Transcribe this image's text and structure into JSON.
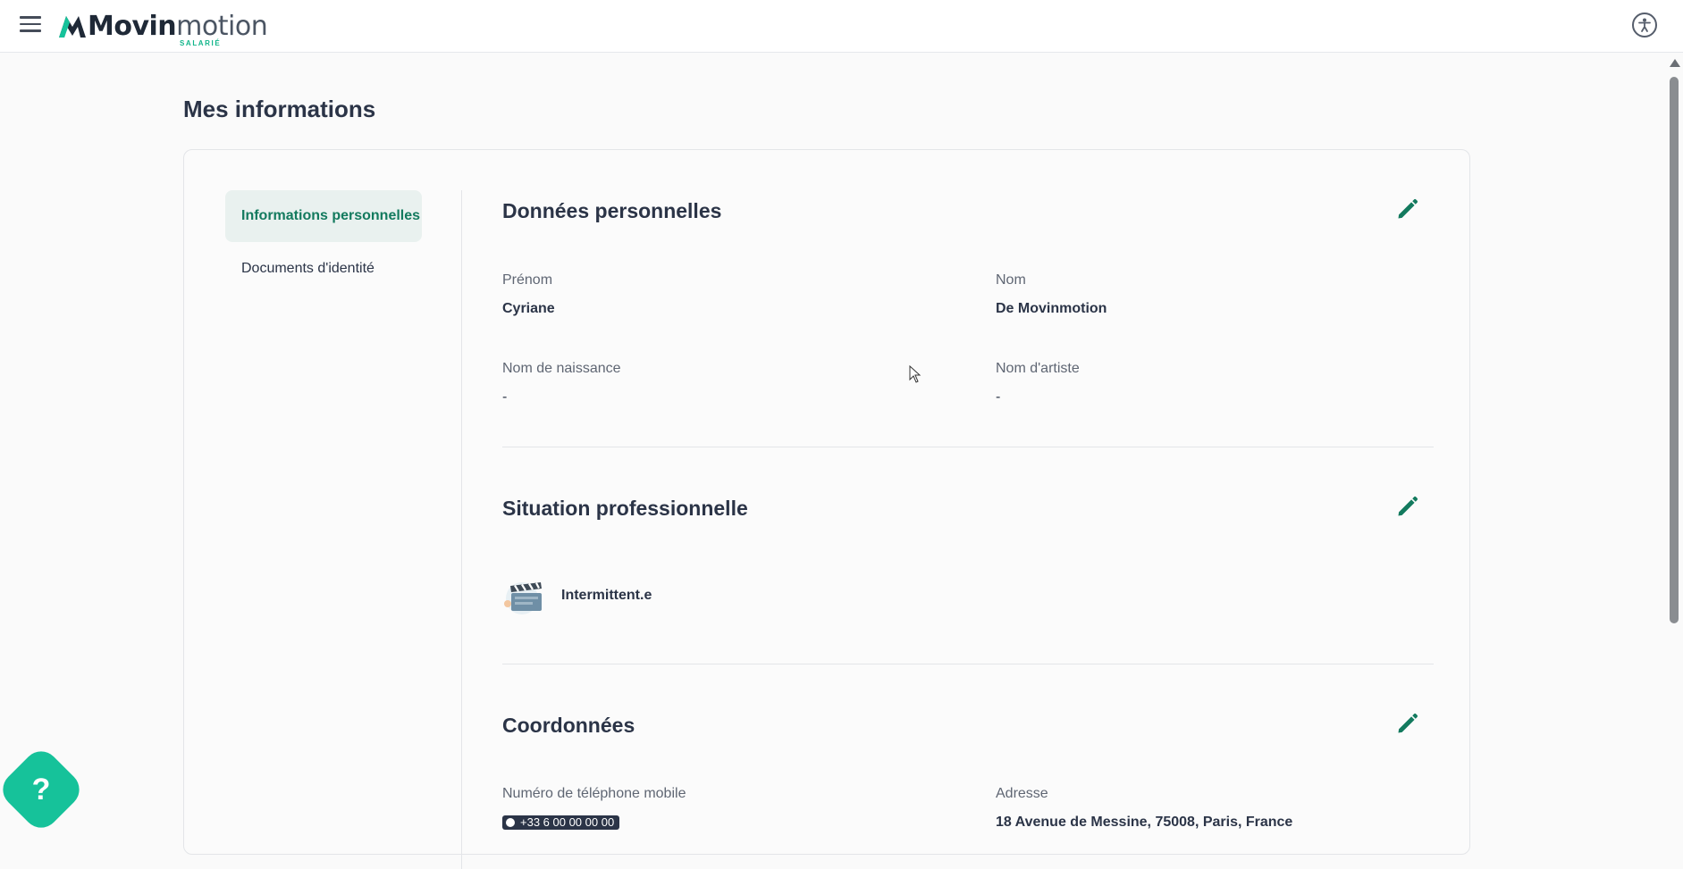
{
  "header": {
    "logo_text_bold": "Movin",
    "logo_text_light": "motion",
    "logo_subtitle": "SALARIÉ",
    "menu_icon": "hamburger-icon",
    "accessibility_icon": "accessibility-icon"
  },
  "page": {
    "title": "Mes informations"
  },
  "sidebar": {
    "items": [
      {
        "label": "Informations personnelles",
        "active": true
      },
      {
        "label": "Documents d'identité",
        "active": false
      }
    ]
  },
  "sections": {
    "personal": {
      "title": "Données personnelles",
      "fields": [
        {
          "label": "Prénom",
          "value": "Cyriane"
        },
        {
          "label": "Nom",
          "value": "De Movinmotion"
        },
        {
          "label": "Nom de naissance",
          "value": "-"
        },
        {
          "label": "Nom d'artiste",
          "value": "-"
        }
      ]
    },
    "professional": {
      "title": "Situation professionnelle",
      "status": "Intermittent.e",
      "status_icon": "clapperboard-icon"
    },
    "contact": {
      "title": "Coordonnées",
      "phone_label": "Numéro de téléphone mobile",
      "phone_value": "+33 6 00 00 00 00",
      "address_label": "Adresse",
      "address_value": "18 Avenue de Messine, 75008, Paris, France"
    }
  },
  "help": {
    "glyph": "?"
  },
  "colors": {
    "accent": "#137a5e",
    "help_button": "#16c29a",
    "text": "#2b3447"
  }
}
